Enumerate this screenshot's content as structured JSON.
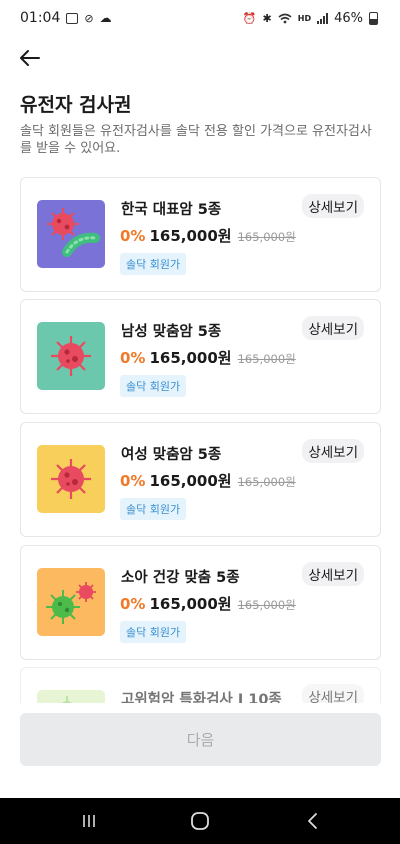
{
  "status_bar": {
    "time": "01:04",
    "hd_label": "HD",
    "battery_percent": "46%"
  },
  "header": {
    "title": "유전자 검사권",
    "subtitle": "솔닥 회원들은 유전자검사를 솔닥 전용 할인 가격으로 유전자검사를 받을 수 있어요."
  },
  "products": [
    {
      "name": "한국 대표암 5종",
      "discount": "0%",
      "price": "165,000원",
      "original_price": "165,000원",
      "badge": "솔닥 회원가",
      "detail_label": "상세보기",
      "thumb_color": "#7b72d8",
      "icon": "virus-bacteria-icon"
    },
    {
      "name": "남성 맞춤암 5종",
      "discount": "0%",
      "price": "165,000원",
      "original_price": "165,000원",
      "badge": "솔닥 회원가",
      "detail_label": "상세보기",
      "thumb_color": "#6cc8ad",
      "icon": "virus-icon"
    },
    {
      "name": "여성 맞춤암 5종",
      "discount": "0%",
      "price": "165,000원",
      "original_price": "165,000원",
      "badge": "솔닥 회원가",
      "detail_label": "상세보기",
      "thumb_color": "#f7cf5a",
      "icon": "virus-icon"
    },
    {
      "name": "소아 건강 맞춤 5종",
      "discount": "0%",
      "price": "165,000원",
      "original_price": "165,000원",
      "badge": "솔닥 회원가",
      "detail_label": "상세보기",
      "thumb_color": "#fdb960",
      "icon": "germs-icon"
    },
    {
      "name": "고위험암 특화검사 I 10종",
      "detail_label": "상세보기",
      "thumb_color": "#d9f0b8",
      "icon": "germs-icon"
    }
  ],
  "footer": {
    "next_label": "다음"
  },
  "colors": {
    "discount": "#f07a2a",
    "badge_bg": "#e5f3fc",
    "badge_text": "#3a8fd0",
    "next_disabled_bg": "#e9eaec"
  }
}
